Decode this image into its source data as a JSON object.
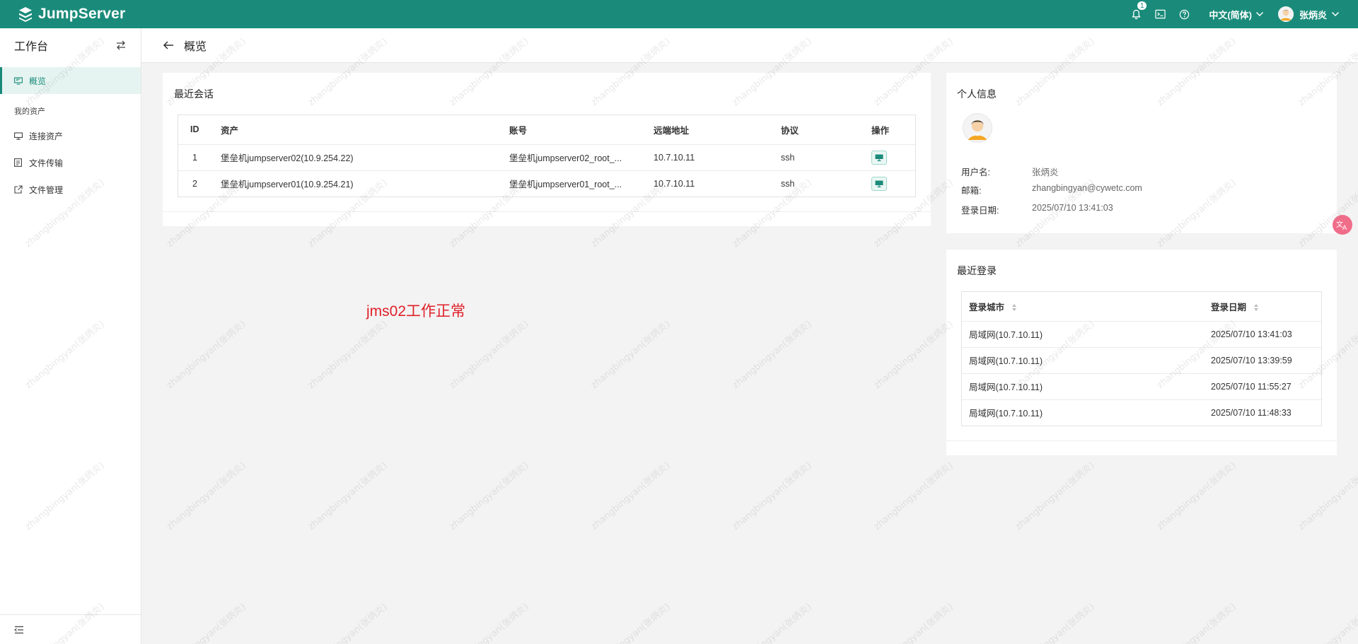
{
  "app": {
    "brand": "JumpServer",
    "notification_count": "1",
    "language": "中文(简体)",
    "user_name": "张炳炎"
  },
  "sidebar": {
    "title": "工作台",
    "items": [
      {
        "label": "概览",
        "icon": "monitor-icon",
        "active": true
      },
      {
        "label": "连接资产",
        "icon": "desktop-icon"
      },
      {
        "label": "文件传输",
        "icon": "file-transfer-icon"
      },
      {
        "label": "文件管理",
        "icon": "external-link-icon"
      }
    ],
    "group_label": "我的资产"
  },
  "header": {
    "title": "概览"
  },
  "recent_sessions": {
    "title": "最近会话",
    "columns": [
      "ID",
      "资产",
      "账号",
      "远端地址",
      "协议",
      "操作"
    ],
    "rows": [
      {
        "id": "1",
        "asset": "堡垒机jumpserver02(10.9.254.22)",
        "account": "堡垒机jumpserver02_root_...",
        "remote": "10.7.10.11",
        "protocol": "ssh"
      },
      {
        "id": "2",
        "asset": "堡垒机jumpserver01(10.9.254.21)",
        "account": "堡垒机jumpserver01_root_...",
        "remote": "10.7.10.11",
        "protocol": "ssh"
      }
    ]
  },
  "personal_info": {
    "title": "个人信息",
    "username_label": "用户名:",
    "username": "张炳炎",
    "email_label": "邮箱:",
    "email": "zhangbingyan@cywetc.com",
    "login_date_label": "登录日期:",
    "login_date": "2025/07/10 13:41:03"
  },
  "recent_logins": {
    "title": "最近登录",
    "columns": [
      "登录城市",
      "登录日期"
    ],
    "rows": [
      {
        "city": "局域网(10.7.10.11)",
        "date": "2025/07/10 13:41:03"
      },
      {
        "city": "局域网(10.7.10.11)",
        "date": "2025/07/10 13:39:59"
      },
      {
        "city": "局域网(10.7.10.11)",
        "date": "2025/07/10 11:55:27"
      },
      {
        "city": "局域网(10.7.10.11)",
        "date": "2025/07/10 11:48:33"
      }
    ]
  },
  "annotation": "jms02工作正常",
  "watermark": "zhangbingyan(张炳炎)",
  "colors": {
    "brand": "#1a8b7a",
    "annotation": "#e0202a"
  }
}
